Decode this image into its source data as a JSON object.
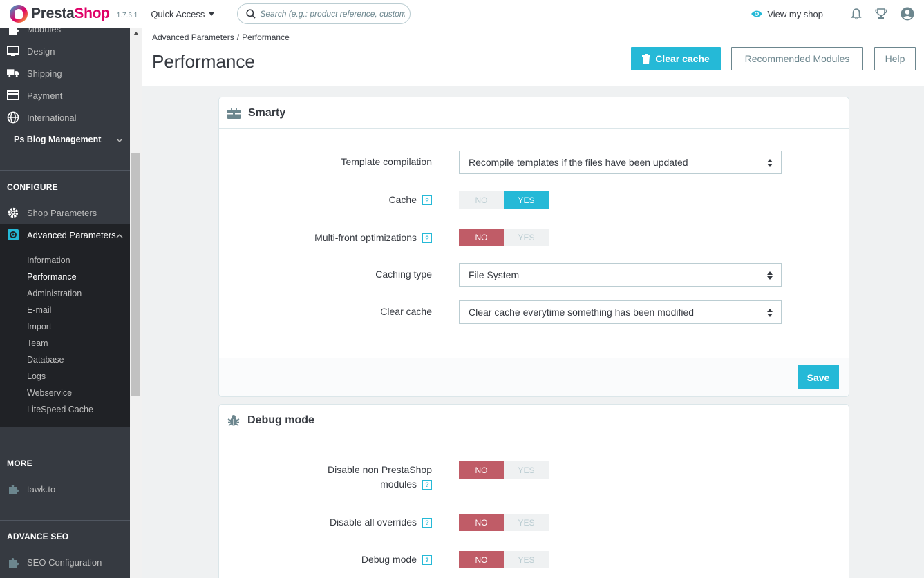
{
  "header": {
    "logo_presta": "Presta",
    "logo_shop": "Shop",
    "version": "1.7.6.1",
    "quick_access": "Quick Access",
    "search_placeholder": "Search (e.g.: product reference, custome",
    "view_shop": "View my shop",
    "icons": [
      "eye-icon",
      "bell-icon",
      "trophy-icon",
      "user-icon"
    ]
  },
  "sidebar": {
    "items": [
      {
        "label": "Modules",
        "icon": "puzzle-icon"
      },
      {
        "label": "Design",
        "icon": "monitor-icon"
      },
      {
        "label": "Shipping",
        "icon": "truck-icon"
      },
      {
        "label": "Payment",
        "icon": "credit-card-icon"
      },
      {
        "label": "International",
        "icon": "globe-icon"
      }
    ],
    "blog": "Ps Blog Management",
    "configure": "CONFIGURE",
    "shop_parameters": "Shop Parameters",
    "advanced_parameters": "Advanced Parameters",
    "submenu": [
      "Information",
      "Performance",
      "Administration",
      "E-mail",
      "Import",
      "Team",
      "Database",
      "Logs",
      "Webservice",
      "LiteSpeed Cache"
    ],
    "more": "MORE",
    "tawk": "tawk.to",
    "advance_seo": "ADVANCE SEO",
    "seo_config": "SEO Configuration"
  },
  "toolbar": {
    "breadcrumb_parent": "Advanced Parameters",
    "breadcrumb_sep": "/",
    "breadcrumb_current": "Performance",
    "title": "Performance",
    "clear_cache": "Clear cache",
    "recommended": "Recommended Modules",
    "help": "Help"
  },
  "smarty": {
    "title": "Smarty",
    "template_label": "Template compilation",
    "template_value": "Recompile templates if the files have been updated",
    "cache_label": "Cache",
    "cache_value": "YES",
    "multifront_label": "Multi-front optimizations",
    "multifront_value": "NO",
    "caching_type_label": "Caching type",
    "caching_type_value": "File System",
    "clear_cache_label": "Clear cache",
    "clear_cache_value": "Clear cache everytime something has been modified",
    "save": "Save"
  },
  "debug": {
    "title": "Debug mode",
    "disable_non_ps_label_1": "Disable non PrestaShop",
    "disable_non_ps_label_2": "modules",
    "disable_non_ps_value": "NO",
    "disable_overrides_label": "Disable all overrides",
    "disable_overrides_value": "NO",
    "debug_mode_label": "Debug mode",
    "debug_mode_value": "NO"
  },
  "switch": {
    "no": "NO",
    "yes": "YES"
  },
  "help_mark": "?",
  "colors": {
    "accent": "#25b9d7",
    "danger": "#c05c67",
    "sidebar": "#363a41",
    "brand_pink": "#df0067"
  }
}
